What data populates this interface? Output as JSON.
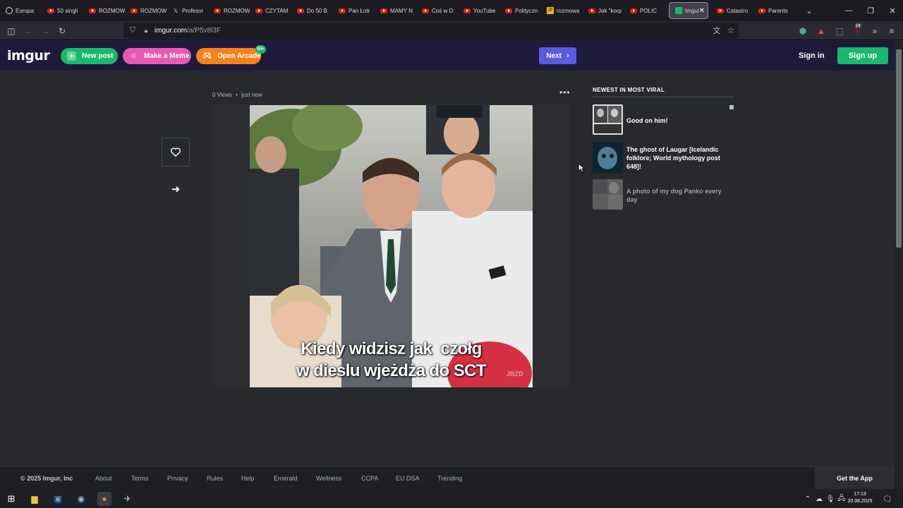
{
  "browser": {
    "tabs": [
      {
        "label": "Europa:",
        "icon": "globe-icon"
      },
      {
        "label": "50 singli",
        "icon": "youtube-icon"
      },
      {
        "label": "ROZMOW",
        "icon": "youtube-icon"
      },
      {
        "label": "ROZMOW",
        "icon": "youtube-icon"
      },
      {
        "label": "Profesor",
        "icon": "x-icon"
      },
      {
        "label": "ROZMOW",
        "icon": "youtube-icon"
      },
      {
        "label": "CZYTAM",
        "icon": "youtube-icon"
      },
      {
        "label": "Do 50 B",
        "icon": "youtube-icon"
      },
      {
        "label": "Pan Łotr",
        "icon": "youtube-icon"
      },
      {
        "label": "MAMY N",
        "icon": "youtube-icon"
      },
      {
        "label": "Coś w D",
        "icon": "youtube-icon"
      },
      {
        "label": "YouTube",
        "icon": "youtube-icon"
      },
      {
        "label": "Polityczn",
        "icon": "youtube-icon"
      },
      {
        "label": "rozmowa",
        "icon": "jp-icon"
      },
      {
        "label": "Jak \"korp",
        "icon": "youtube-icon"
      },
      {
        "label": "POLIC",
        "icon": "youtube-icon"
      },
      {
        "label": "Imgur",
        "icon": "imgur-icon",
        "active": true
      },
      {
        "label": "Catastro",
        "icon": "youtube-icon"
      },
      {
        "label": "Parents",
        "icon": "youtube-icon"
      }
    ],
    "url_domain": "imgur.com",
    "url_path": "/a/P5v8l3F",
    "extension_badge": "14"
  },
  "header": {
    "logo": "imgur",
    "new_post": "New post",
    "make_meme": "Make a Meme",
    "open_arcade": "Open Arcade",
    "arcade_badge": "50+",
    "next": "Next",
    "sign_in": "Sign in",
    "sign_up": "Sign up"
  },
  "post": {
    "views": "0 Views",
    "separator": "•",
    "time": "just now",
    "caption_line1": "Kiedy widzisz jak  czołg",
    "caption_line2": "w dieslu wjeżdża do SCT",
    "watermark": "JBZD"
  },
  "sidebar": {
    "title": "NEWEST IN MOST VIRAL",
    "items": [
      {
        "title": "Good on him!"
      },
      {
        "title": "The ghost of Laugar [Icelandic folklore; World mythology post 648]!"
      },
      {
        "title": "A photo of my dog Panko every day"
      }
    ]
  },
  "footer": {
    "copyright": "© 2025 Imgur, Inc",
    "links": [
      "About",
      "Terms",
      "Privacy",
      "Rules",
      "Help",
      "Emerald",
      "Wellness",
      "CCPA",
      "EU DSA",
      "Trending"
    ],
    "get_app": "Get the App"
  },
  "taskbar": {
    "time": "17:13",
    "date": "20.08.2025"
  },
  "colors": {
    "imgur_header": "#1e1b3a",
    "new_post_green": "#1bb76e",
    "meme_pink": "#e85ab1",
    "arcade_orange": "#f5821f",
    "next_blue": "#5b5bdf",
    "page_bg": "#27292d"
  }
}
